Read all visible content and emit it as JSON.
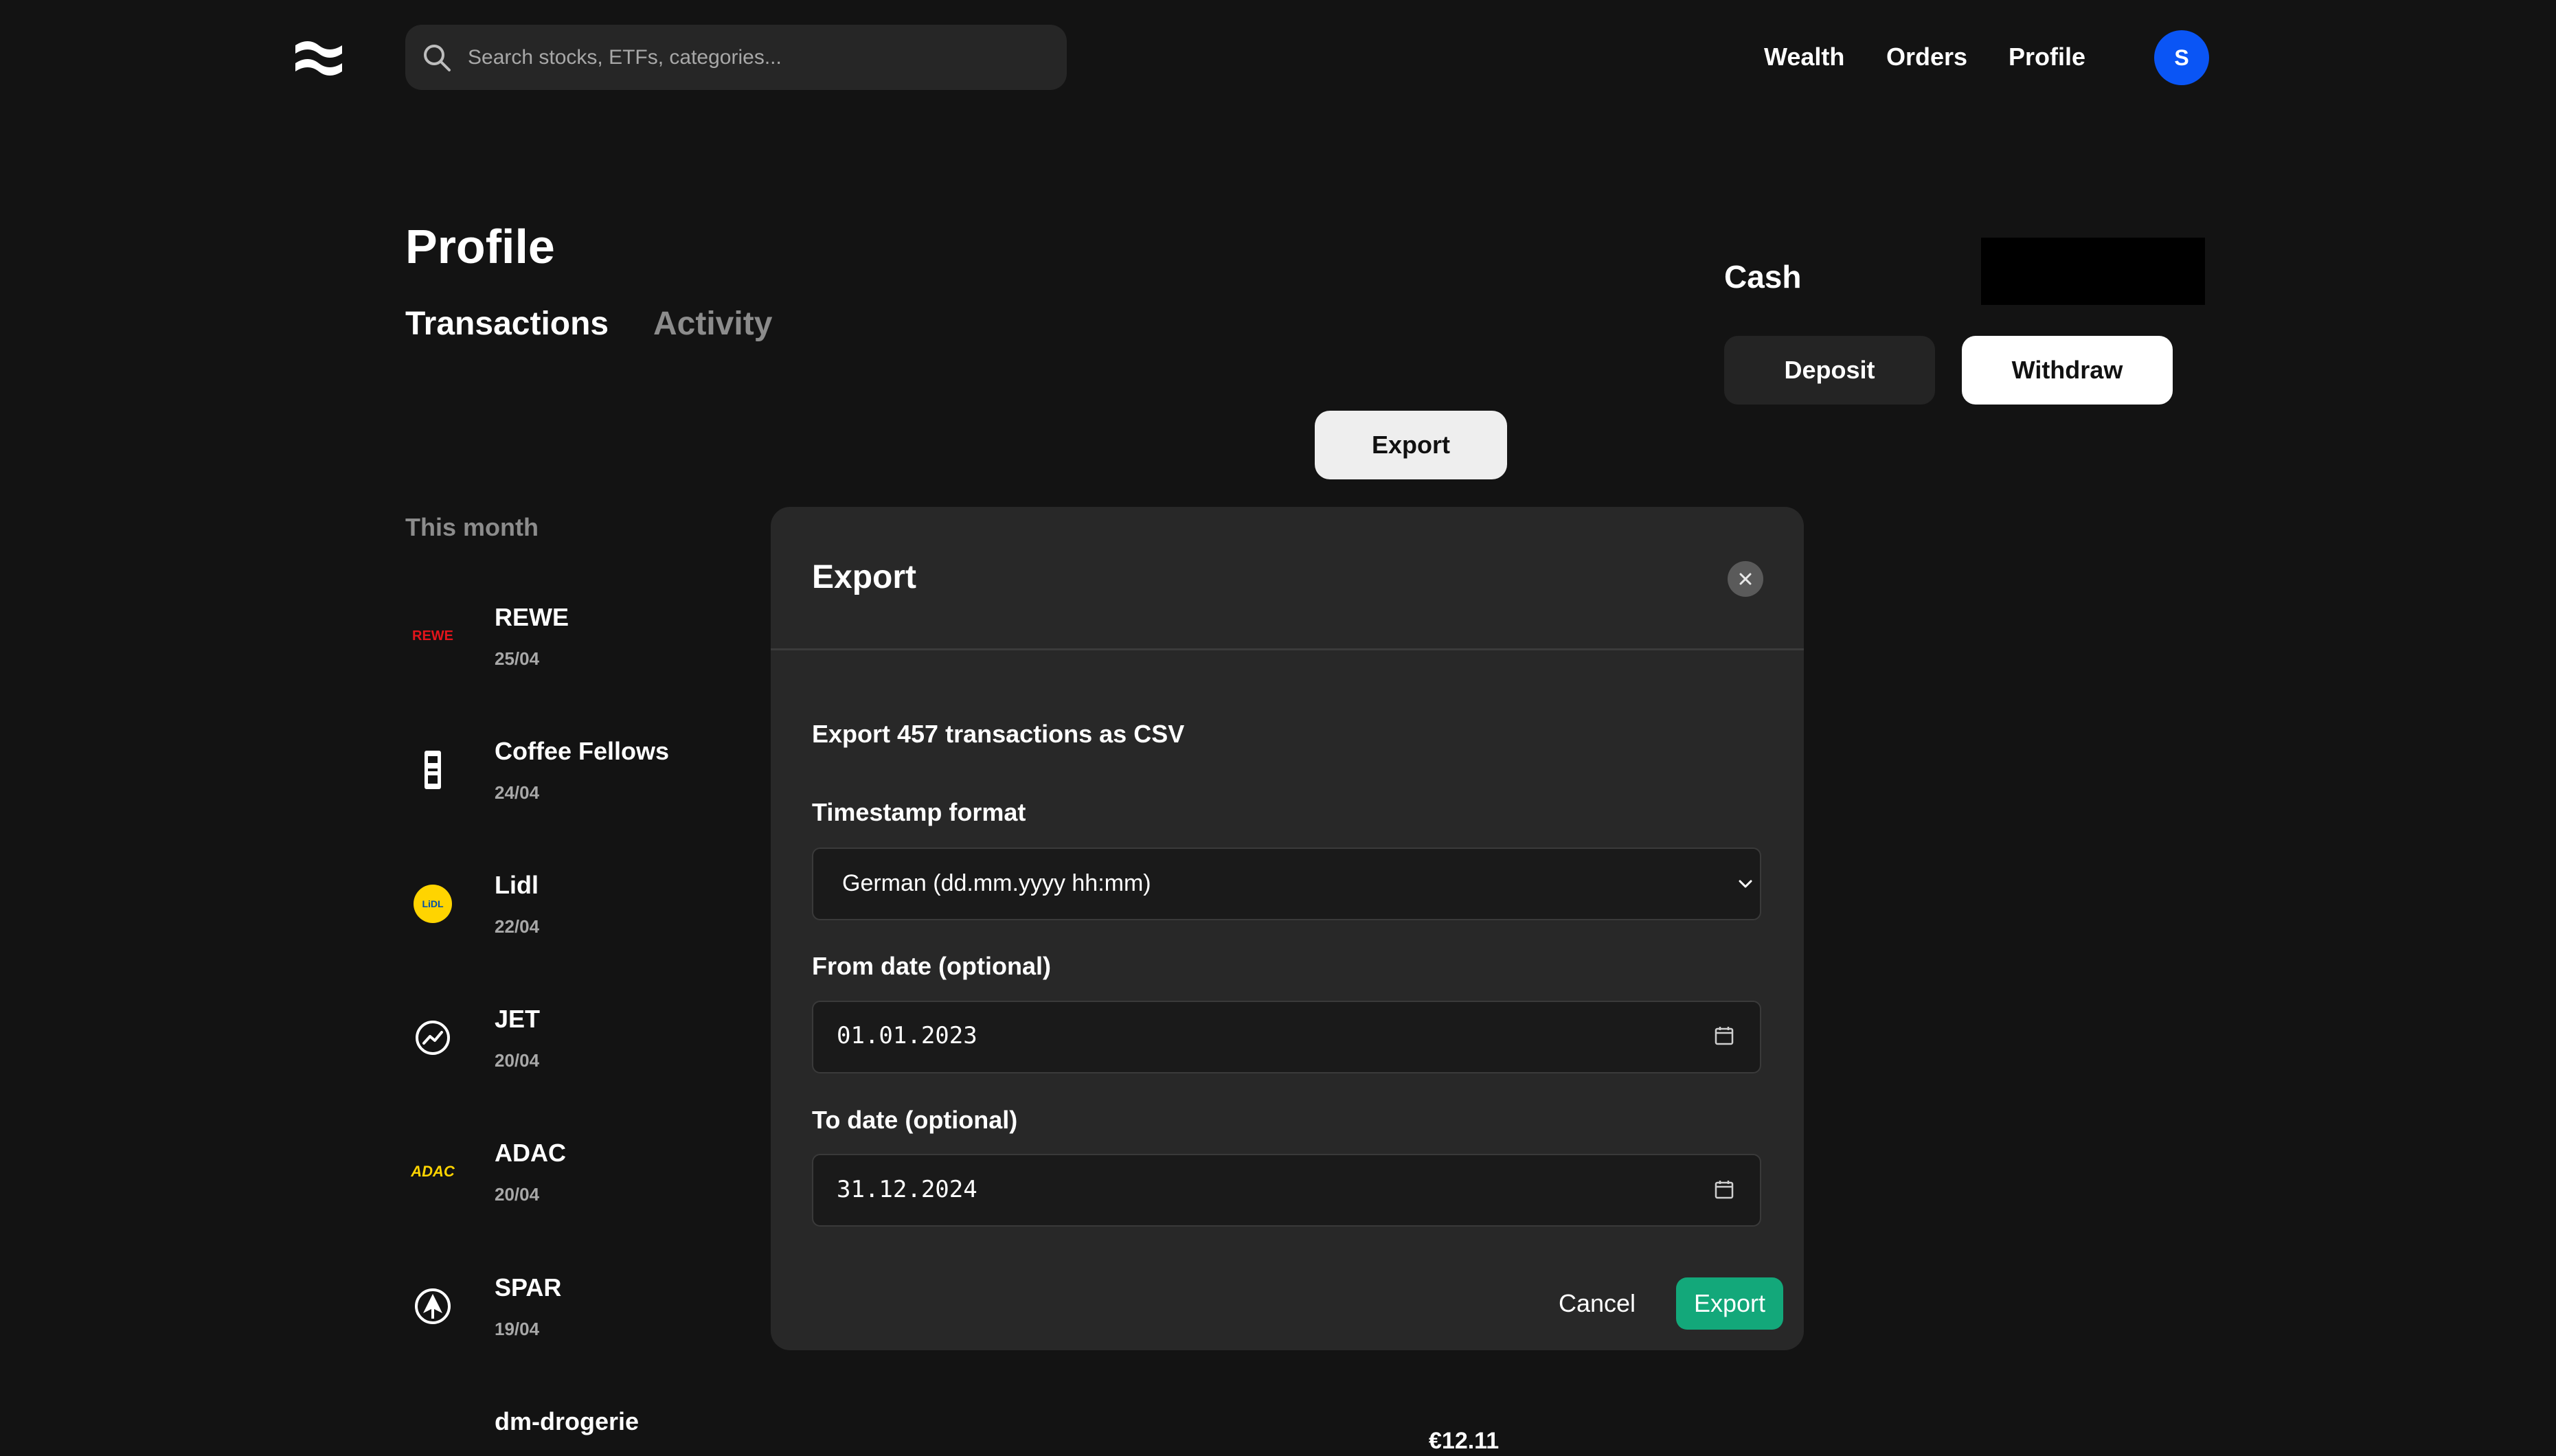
{
  "app": {
    "search_placeholder": "Search stocks, ETFs, categories...",
    "nav": {
      "wealth": "Wealth",
      "orders": "Orders",
      "profile": "Profile"
    },
    "avatar_initial": "S",
    "icons": {
      "logo": "brand-waves-icon",
      "search": "search-icon"
    }
  },
  "page": {
    "title": "Profile",
    "tabs": [
      {
        "label": "Transactions",
        "active": true
      },
      {
        "label": "Activity",
        "active": false
      }
    ],
    "cash_label": "Cash",
    "deposit_label": "Deposit",
    "withdraw_label": "Withdraw",
    "export_button": "Export"
  },
  "transactions": {
    "section_label": "This month",
    "items": [
      {
        "name": "REWE",
        "date": "25/04",
        "logo_text": "REWE",
        "logo_color": "#e3141b"
      },
      {
        "name": "Coffee Fellows",
        "date": "24/04",
        "logo_icon": "coffee-cup-icon"
      },
      {
        "name": "Lidl",
        "date": "22/04",
        "logo_text": "LiDL",
        "logo_color": "#ffd400"
      },
      {
        "name": "JET",
        "date": "20/04",
        "logo_icon": "trend-circle-icon"
      },
      {
        "name": "ADAC",
        "date": "20/04",
        "logo_text": "ADAC",
        "logo_color": "#ffd400"
      },
      {
        "name": "SPAR",
        "date": "19/04",
        "logo_icon": "spar-tree-icon"
      },
      {
        "name": "dm-drogerie",
        "date": "",
        "logo_icon": "dm-logo-icon"
      }
    ],
    "peek_amount": "€12.11"
  },
  "modal": {
    "title": "Export",
    "description": "Export 457 transactions as CSV",
    "timestamp_label": "Timestamp format",
    "timestamp_value": "German (dd.mm.yyyy hh:mm)",
    "from_label": "From date (optional)",
    "from_value": "01.01.2023",
    "to_label": "To date (optional)",
    "to_value": "31.12.2024",
    "cancel_label": "Cancel",
    "export_label": "Export"
  },
  "colors": {
    "background": "#131313",
    "modal": "#282828",
    "primary_export": "#13a87a",
    "avatar": "#0a55f5"
  }
}
